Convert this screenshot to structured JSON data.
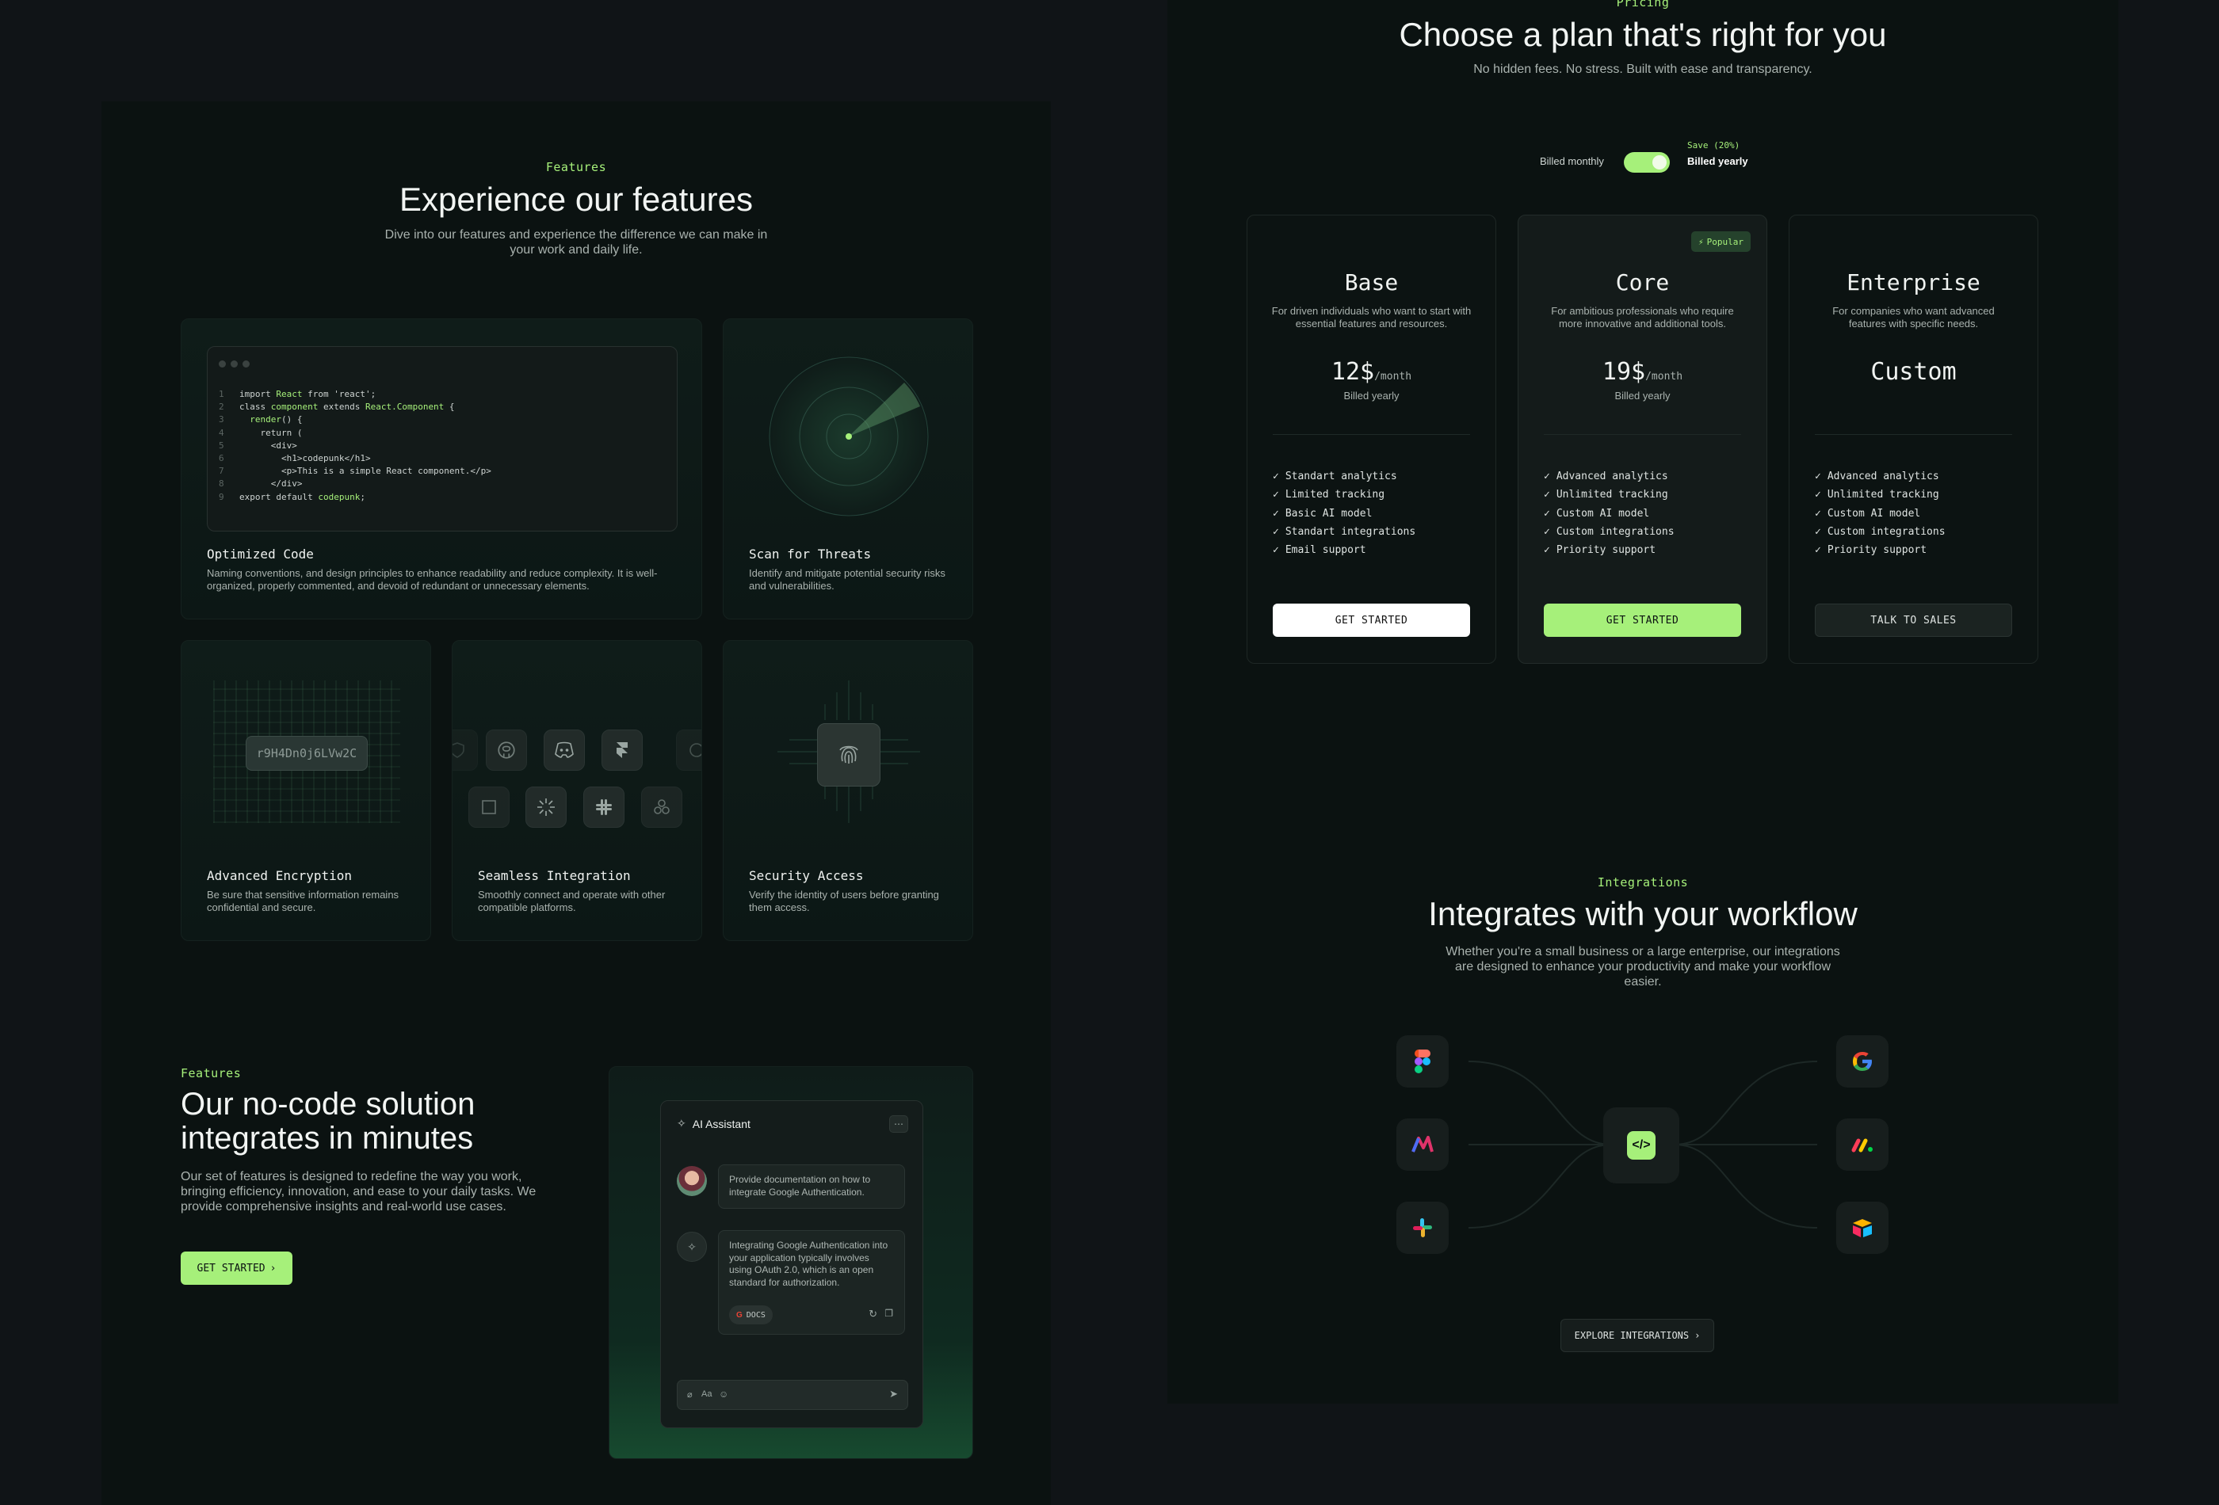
{
  "features": {
    "eyebrow": "Features",
    "title": "Experience our features",
    "subtitle": "Dive into our features and experience the difference we can make in your work and daily life.",
    "cards": [
      {
        "title": "Optimized Code",
        "desc": "Naming conventions, and design principles to enhance readability and reduce complexity. It is well-organized, properly commented, and devoid of redundant or unnecessary elements."
      },
      {
        "title": "Scan for Threats",
        "desc": "Identify and mitigate potential security risks and vulnerabilities."
      },
      {
        "title": "Advanced Encryption",
        "desc": "Be sure that sensitive information remains confidential and secure."
      },
      {
        "title": "Seamless Integration",
        "desc": "Smoothly connect and operate with other compatible platforms."
      },
      {
        "title": "Security Access",
        "desc": "Verify the identity of users before granting them access."
      }
    ],
    "encryption_key": "r9H4Dn0j6LVw2C",
    "code_lines": [
      {
        "n": "1",
        "a": "import ",
        "k": "React",
        "b": " from 'react';"
      },
      {
        "n": "2",
        "a": "class ",
        "k": "component",
        "b": " extends ",
        "k2": "React.Component",
        "c": " {"
      },
      {
        "n": "3",
        "a": "  ",
        "k": "render",
        "b": "() {"
      },
      {
        "n": "4",
        "a": "    return ("
      },
      {
        "n": "5",
        "a": "      <div>"
      },
      {
        "n": "6",
        "a": "        <h1>codepunk</h1>"
      },
      {
        "n": "7",
        "a": "        <p>This is a simple React component.</p>"
      },
      {
        "n": "8",
        "a": "      </div>"
      },
      {
        "n": "9",
        "a": "export default ",
        "k": "codepunk",
        "b": ";"
      }
    ]
  },
  "nocode": {
    "eyebrow": "Features",
    "title_line1": "Our no-code solution",
    "title_line2": "integrates in minutes",
    "desc": "Our set of features is designed to redefine the way you work, bringing efficiency, innovation, and ease to your daily tasks. We provide comprehensive insights and real-world use cases.",
    "cta": "GET STARTED",
    "assistant": {
      "title": "AI Assistant",
      "user_msg": "Provide documentation on how to integrate Google Authentication.",
      "bot_msg": "Integrating Google Authentication into your application typically involves using OAuth 2.0, which is an open standard for authorization.",
      "docs_label": "DOCS",
      "input_aa": "Aa"
    }
  },
  "pricing": {
    "eyebrow": "Pricing",
    "title": "Choose a plan that's right for you",
    "subtitle": "No hidden fees. No stress. Built with ease and transparency.",
    "billed_monthly": "Billed monthly",
    "save": "Save (20%)",
    "billed_yearly": "Billed yearly",
    "popular": "Popular",
    "plans": [
      {
        "name": "Base",
        "desc": "For driven individuals who want to start with essential features and resources.",
        "price": "12$",
        "per": "/month",
        "billing": "Billed yearly",
        "features": [
          "Standart analytics",
          "Limited tracking",
          "Basic AI model",
          "Standart integrations",
          "Email support"
        ],
        "cta": "GET STARTED"
      },
      {
        "name": "Core",
        "desc": "For ambitious professionals who require more innovative and additional tools.",
        "price": "19$",
        "per": "/month",
        "billing": "Billed yearly",
        "features": [
          "Advanced analytics",
          "Unlimited tracking",
          "Custom AI model",
          "Custom integrations",
          "Priority support"
        ],
        "cta": "GET STARTED"
      },
      {
        "name": "Enterprise",
        "desc": "For companies who want advanced features with specific needs.",
        "price": "Custom",
        "features": [
          "Advanced analytics",
          "Unlimited tracking",
          "Custom AI model",
          "Custom integrations",
          "Priority support"
        ],
        "cta": "TALK TO SALES"
      }
    ]
  },
  "integrations": {
    "eyebrow": "Integrations",
    "title": "Integrates with your workflow",
    "subtitle": "Whether you're a small business or a large enterprise, our integrations are designed to enhance your productivity and make your workflow easier.",
    "cta": "EXPLORE INTEGRATIONS",
    "icons": [
      "figma-icon",
      "monday-like-icon",
      "slack-icon",
      "google-icon",
      "monday-icon",
      "airtable-icon"
    ]
  },
  "colors": {
    "accent": "#a6f07a",
    "background": "#101417",
    "panel": "#0b1211"
  }
}
